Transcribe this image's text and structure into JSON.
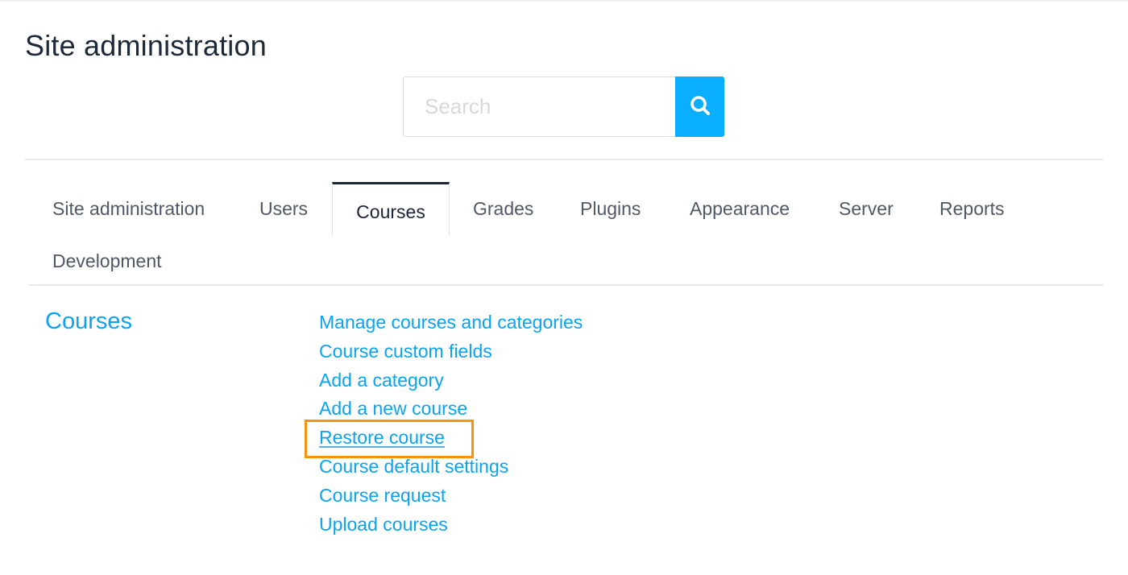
{
  "page": {
    "title": "Site administration"
  },
  "search": {
    "placeholder": "Search",
    "value": "",
    "button_icon": "search-icon",
    "button_color": "#0aaeff"
  },
  "tabs": [
    {
      "label": "Site administration",
      "active": false
    },
    {
      "label": "Users",
      "active": false
    },
    {
      "label": "Courses",
      "active": true
    },
    {
      "label": "Grades",
      "active": false
    },
    {
      "label": "Plugins",
      "active": false
    },
    {
      "label": "Appearance",
      "active": false
    },
    {
      "label": "Server",
      "active": false
    },
    {
      "label": "Reports",
      "active": false
    },
    {
      "label": "Development",
      "active": false
    }
  ],
  "section": {
    "heading": "Courses",
    "links": [
      {
        "label": "Manage courses and categories",
        "highlighted": false
      },
      {
        "label": "Course custom fields",
        "highlighted": false
      },
      {
        "label": "Add a category",
        "highlighted": false
      },
      {
        "label": "Add a new course",
        "highlighted": false
      },
      {
        "label": "Restore course",
        "highlighted": true
      },
      {
        "label": "Course default settings",
        "highlighted": false
      },
      {
        "label": "Course request",
        "highlighted": false
      },
      {
        "label": "Upload courses",
        "highlighted": false
      }
    ]
  },
  "colors": {
    "link": "#0aa3f0",
    "highlight_border": "#f7930a",
    "title_text": "#1d2939"
  }
}
